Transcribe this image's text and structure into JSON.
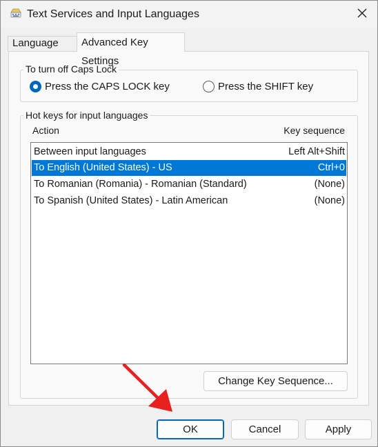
{
  "window": {
    "title": "Text Services and Input Languages"
  },
  "tabs": [
    {
      "label": "Language Bar",
      "active": false
    },
    {
      "label": "Advanced Key Settings",
      "active": true
    }
  ],
  "caps_lock": {
    "group_title": "To turn off Caps Lock",
    "options": [
      {
        "label": "Press the CAPS LOCK key",
        "selected": true
      },
      {
        "label": "Press the SHIFT key",
        "selected": false
      }
    ]
  },
  "hotkeys": {
    "group_title": "Hot keys for input languages",
    "columns": {
      "action": "Action",
      "key_sequence": "Key sequence"
    },
    "rows": [
      {
        "action": "Between input languages",
        "keys": "Left Alt+Shift",
        "selected": false
      },
      {
        "action": "To English (United States) - US",
        "keys": "Ctrl+0",
        "selected": true
      },
      {
        "action": "To Romanian (Romania) - Romanian (Standard)",
        "keys": "(None)",
        "selected": false
      },
      {
        "action": "To Spanish (United States) - Latin American",
        "keys": "(None)",
        "selected": false
      }
    ],
    "change_button": "Change Key Sequence..."
  },
  "footer": {
    "ok": "OK",
    "cancel": "Cancel",
    "apply": "Apply"
  },
  "colors": {
    "selection": "#0078d7",
    "accent": "#0067c0",
    "annotation_arrow": "#e8201f"
  },
  "icons": {
    "app": "keyboard-icon",
    "close": "close-icon",
    "annotation": "red-arrow-icon"
  }
}
